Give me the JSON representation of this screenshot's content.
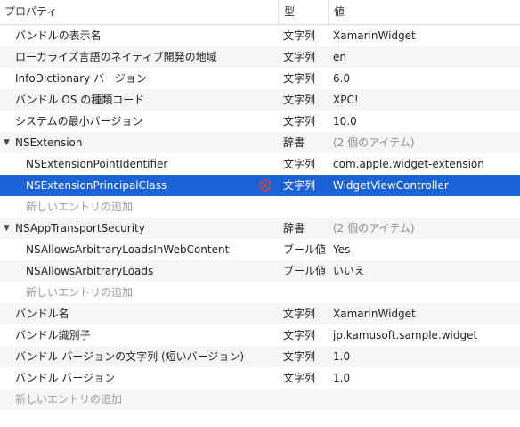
{
  "header": {
    "key": "プロパティ",
    "type": "型",
    "value": "値"
  },
  "rows": [
    {
      "key": "バンドルの表示名",
      "type": "文字列",
      "value": "XamarinWidget"
    },
    {
      "key": "ローカライズ言語のネイティブ開発の地域",
      "type": "文字列",
      "value": "en"
    },
    {
      "key": "InfoDictionary バージョン",
      "type": "文字列",
      "value": "6.0"
    },
    {
      "key": "バンドル OS の種類コード",
      "type": "文字列",
      "value": "XPC!"
    },
    {
      "key": "システムの最小バージョン",
      "type": "文字列",
      "value": "10.0"
    },
    {
      "key": "NSExtension",
      "type": "辞書",
      "value": "(2 個のアイテム)"
    },
    {
      "key": "NSExtensionPointIdentifier",
      "type": "文字列",
      "value": "com.apple.widget-extension"
    },
    {
      "key": "NSExtensionPrincipalClass",
      "type": "文字列",
      "value": "WidgetViewController"
    },
    {
      "key": "新しいエントリの追加"
    },
    {
      "key": "NSAppTransportSecurity",
      "type": "辞書",
      "value": "(2 個のアイテム)"
    },
    {
      "key": "NSAllowsArbitraryLoadsInWebContent",
      "type": "ブール値",
      "value": "Yes"
    },
    {
      "key": "NSAllowsArbitraryLoads",
      "type": "ブール値",
      "value": "いいえ"
    },
    {
      "key": "新しいエントリの追加"
    },
    {
      "key": "バンドル名",
      "type": "文字列",
      "value": "XamarinWidget"
    },
    {
      "key": "バンドル識別子",
      "type": "文字列",
      "value": "jp.kamusoft.sample.widget"
    },
    {
      "key": "バンドル バージョンの文字列 (短いバージョン)",
      "type": "文字列",
      "value": "1.0"
    },
    {
      "key": "バンドル バージョン",
      "type": "文字列",
      "value": "1.0"
    },
    {
      "key": "新しいエントリの追加"
    }
  ],
  "colors": {
    "selection": "#1a62d6",
    "error": "#d9342b",
    "stripe": "#f4f5f5"
  },
  "icons": {
    "expanded": "disclosure-triangle-down-icon",
    "remove": "remove-circle-icon"
  }
}
